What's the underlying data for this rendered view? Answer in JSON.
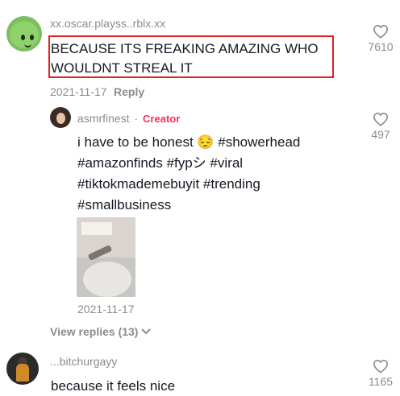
{
  "comments": [
    {
      "username": "xx.oscar.playss..rblx.xx",
      "text_line1": "BECAUSE ITS FREAKING AMAZING WHO",
      "text_line2": "WOULDNT STREAL IT",
      "date": "2021-11-17",
      "reply_label": "Reply",
      "likes": "7610"
    }
  ],
  "reply": {
    "username": "asmrfinest",
    "separator": "·",
    "badge": "Creator",
    "line1": "i have to be honest 😔 #showerhead",
    "line2": "#amazonfinds #fypシ #viral",
    "line3": "#tiktokmademebuyit #trending",
    "line4": "#smallbusiness",
    "date": "2021-11-17",
    "likes": "497"
  },
  "view_replies": "View replies (13)",
  "comment3": {
    "username": "...bitchurgayy",
    "text": "because it feels nice",
    "likes": "1165"
  },
  "colors": {
    "highlight": "#e02020",
    "creator": "#fe2c55",
    "muted": "#8a8b91",
    "text": "#161823"
  },
  "icons": [
    "heart-outline-icon",
    "chevron-down-icon"
  ]
}
